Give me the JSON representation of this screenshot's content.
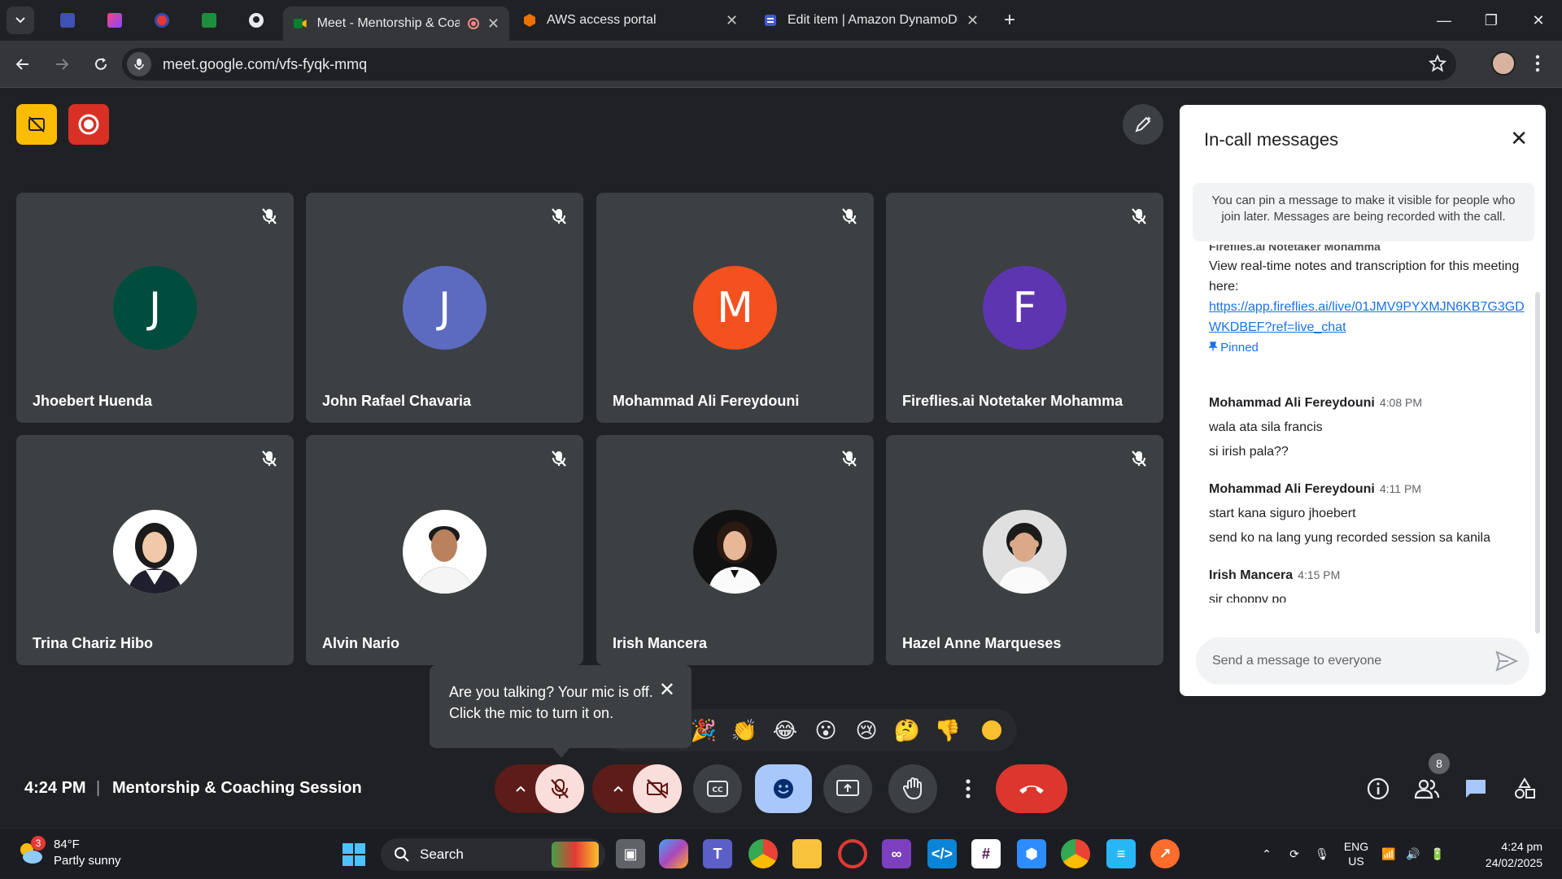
{
  "browser": {
    "tabs": [
      {
        "title": "Meet - Mentorship & Coaching Session",
        "active": true
      },
      {
        "title": "AWS access portal",
        "active": false
      },
      {
        "title": "Edit item | Amazon DynamoDB",
        "active": false
      }
    ],
    "url": "meet.google.com/vfs-fyqk-mmq"
  },
  "meeting": {
    "time": "4:24 PM",
    "separator": "|",
    "title": "Mentorship & Coaching Session",
    "people_count": "8"
  },
  "participants": [
    {
      "name": "Jhoebert Huenda",
      "initial": "J",
      "color": "#004d40",
      "photo": false
    },
    {
      "name": "John Rafael Chavaria",
      "initial": "J",
      "color": "#5c6bc0",
      "photo": false
    },
    {
      "name": "Mohammad Ali Fereydouni",
      "initial": "M",
      "color": "#f4511e",
      "photo": false
    },
    {
      "name": "Fireflies.ai Notetaker Mohamma",
      "initial": "F",
      "color": "#5e35b1",
      "photo": false
    },
    {
      "name": "Trina Chariz Hibo",
      "initial": "",
      "color": "#ffffff",
      "photo": true
    },
    {
      "name": "Alvin Nario",
      "initial": "",
      "color": "#ffffff",
      "photo": true
    },
    {
      "name": "Irish Mancera",
      "initial": "",
      "color": "#111111",
      "photo": true
    },
    {
      "name": "Hazel Anne Marqueses",
      "initial": "",
      "color": "#e0e0e0",
      "photo": true
    }
  ],
  "tooltip": {
    "text": "Are you talking? Your mic is off. Click the mic to turn it on."
  },
  "reactions": [
    "🎉",
    "👏",
    "😂",
    "😮",
    "😢",
    "🤔",
    "👎"
  ],
  "chat": {
    "title": "In-call messages",
    "notice": "You can pin a message to make it visible for people who join later. Messages are being recorded with the call.",
    "pinned_header": "Fireflies.ai Notetaker Mohamma",
    "pinned_text": "View real-time notes and transcription for this meeting here:",
    "pinned_link": "https://app.fireflies.ai/live/01JMV9PYXMJN6KB7G3GDWKDBEF?ref=live_chat",
    "pinned_label": "Pinned",
    "messages": [
      {
        "sender": "Mohammad Ali Fereydouni",
        "time": "4:08 PM",
        "lines": [
          "wala ata sila francis",
          "si irish pala??"
        ]
      },
      {
        "sender": "Mohammad Ali Fereydouni",
        "time": "4:11 PM",
        "lines": [
          "start kana siguro jhoebert",
          "send ko na lang yung recorded session sa kanila"
        ]
      },
      {
        "sender": "Irish Mancera",
        "time": "4:15 PM",
        "lines": [
          "sir choppy po"
        ]
      }
    ],
    "input_placeholder": "Send a message to everyone"
  },
  "taskbar": {
    "weather_temp": "84°F",
    "weather_desc": "Partly sunny",
    "weather_alert": "3",
    "search_label": "Search",
    "lang_top": "ENG",
    "lang_bottom": "US",
    "clock_time": "4:24 pm",
    "clock_date": "24/02/2025"
  }
}
